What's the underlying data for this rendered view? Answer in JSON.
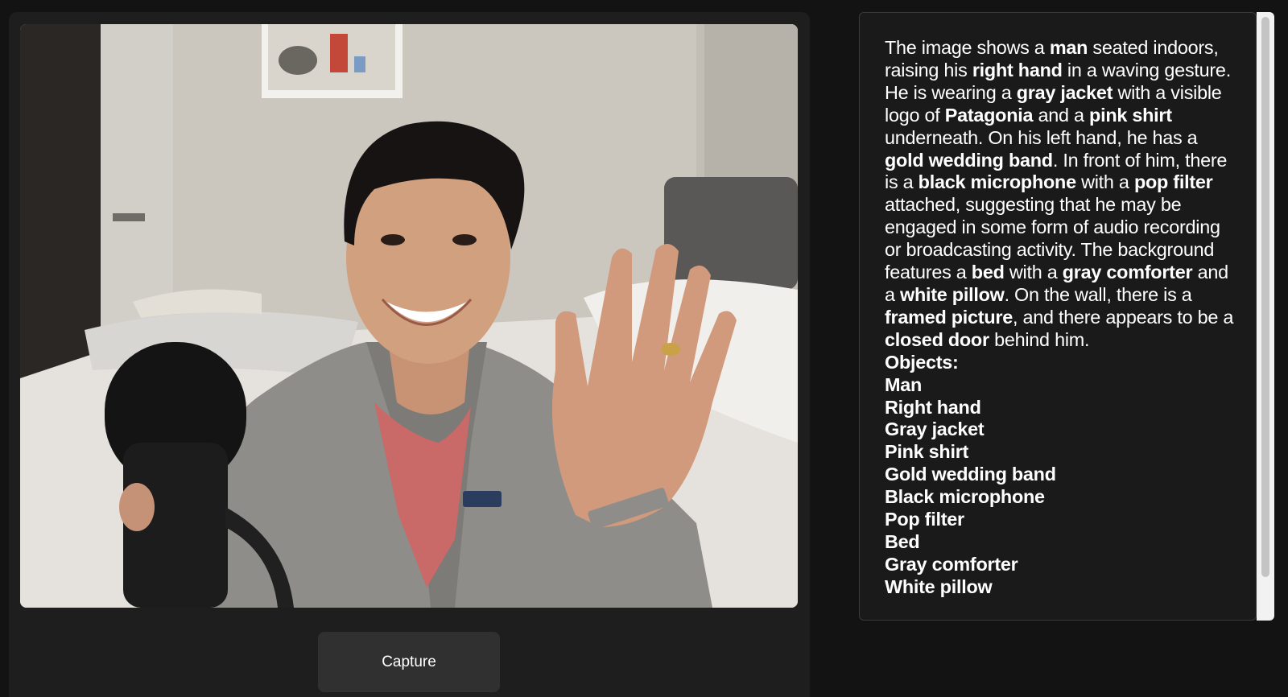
{
  "capture": {
    "label": "Capture"
  },
  "description": {
    "segments": [
      {
        "t": "The image shows a "
      },
      {
        "t": "man",
        "b": true
      },
      {
        "t": " seated indoors, raising his "
      },
      {
        "t": "right hand",
        "b": true
      },
      {
        "t": " in a waving gesture. He is wearing a "
      },
      {
        "t": "gray jacket",
        "b": true
      },
      {
        "t": " with a visible logo of "
      },
      {
        "t": "Patagonia",
        "b": true
      },
      {
        "t": " and a "
      },
      {
        "t": "pink shirt",
        "b": true
      },
      {
        "t": " underneath. On his left hand, he has a "
      },
      {
        "t": "gold wedding band",
        "b": true
      },
      {
        "t": ". In front of him, there is a "
      },
      {
        "t": "black microphone",
        "b": true
      },
      {
        "t": " with a "
      },
      {
        "t": "pop filter",
        "b": true
      },
      {
        "t": " attached, suggesting that he may be engaged in some form of audio recording or broadcasting activity. The background features a "
      },
      {
        "t": "bed",
        "b": true
      },
      {
        "t": " with a "
      },
      {
        "t": "gray comforter",
        "b": true
      },
      {
        "t": " and a "
      },
      {
        "t": "white pillow",
        "b": true
      },
      {
        "t": ". On the wall, there is a "
      },
      {
        "t": "framed picture",
        "b": true
      },
      {
        "t": ", and there appears to be a "
      },
      {
        "t": "closed door",
        "b": true
      },
      {
        "t": " behind him."
      }
    ],
    "objects_title": "Objects:",
    "objects": [
      "Man",
      "Right hand",
      "Gray jacket",
      "Pink shirt",
      "Gold wedding band",
      "Black microphone",
      "Pop filter",
      "Bed",
      "Gray comforter",
      "White pillow"
    ]
  },
  "colors": {
    "background": "#131313",
    "panel": "#1e1e1e",
    "button": "#303030",
    "text": "#ffffff"
  }
}
